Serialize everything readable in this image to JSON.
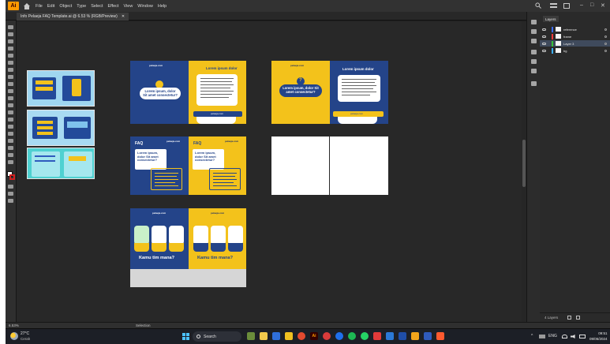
{
  "app": {
    "logo_text": "Ai",
    "menu": [
      "File",
      "Edit",
      "Object",
      "Type",
      "Select",
      "Effect",
      "View",
      "Window",
      "Help"
    ],
    "window_controls": [
      "–",
      "□",
      "✕"
    ],
    "tab_title": "Info Pelaeja FAQ Template.ai @ 6.53 % (RGB/Preview)",
    "tab_close": "✕"
  },
  "layers": {
    "tab_label": "Layers",
    "items": [
      {
        "name": "reference",
        "color": "#3b6cff"
      },
      {
        "name": "frame",
        "color": "#ff3b3b"
      },
      {
        "name": "Layer 3",
        "color": "#36c23a"
      },
      {
        "name": "bg",
        "color": "#3bb0ff"
      }
    ],
    "footer": "4 Layers"
  },
  "status": {
    "zoom": "6.53%",
    "tool": "Selection"
  },
  "artboards": {
    "logo": "pelaeja.com",
    "lorem_dolor": "Lorem ipsum dolor",
    "lorem_sit": "Lorem ipsum, dolor Sit amet consectetur?",
    "lorem_question": "Lorem ipsum, dolor Sit amet consectetur?",
    "faq": "FAQ",
    "kamu": "Kamu tim mana?",
    "footer_url": "pelaeja.com"
  },
  "taskbar": {
    "weather_temp": "27°C",
    "weather_desc": "Cerah",
    "search": "Search",
    "lang": "ENG",
    "time": "09:51",
    "date": "09/06/2024"
  },
  "colors": {
    "blue": "#244489",
    "yellow": "#f3c21b",
    "canvas": "#282828",
    "accent": "#ff9a00"
  }
}
